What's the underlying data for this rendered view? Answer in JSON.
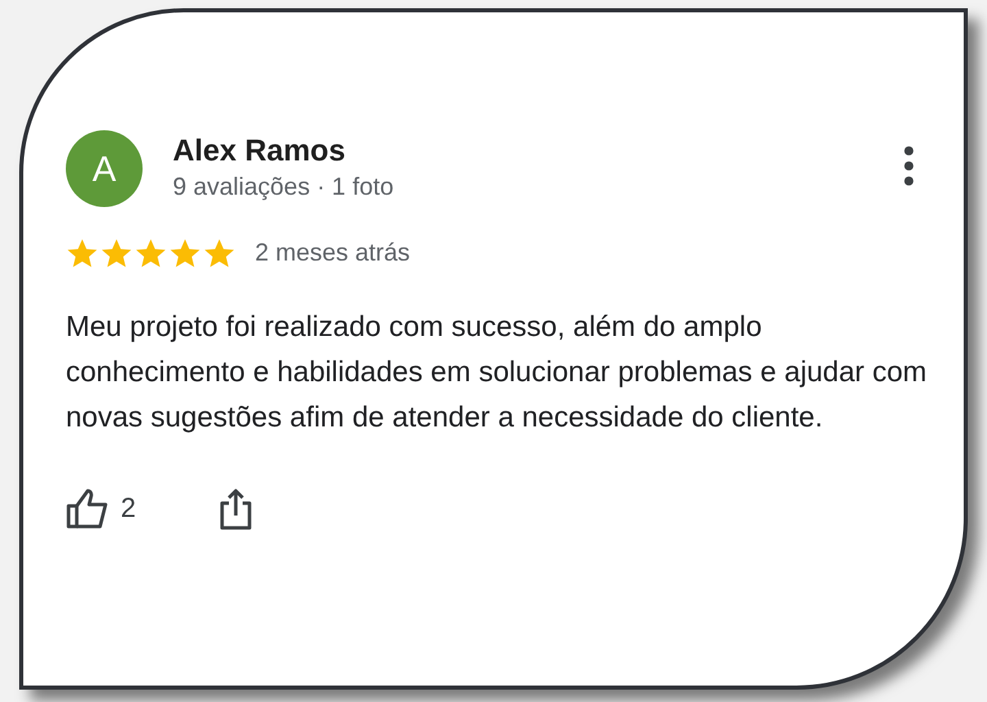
{
  "review": {
    "avatar_letter": "A",
    "name": "Alex Ramos",
    "meta": "9 avaliações · 1 foto",
    "stars": 5,
    "time": "2 meses atrás",
    "text": "Meu projeto foi realizado com sucesso, além do amplo conhecimento e habilidades em solucionar problemas e ajudar com novas sugestões afim de atender a necessidade do cliente.",
    "likes": "2"
  }
}
